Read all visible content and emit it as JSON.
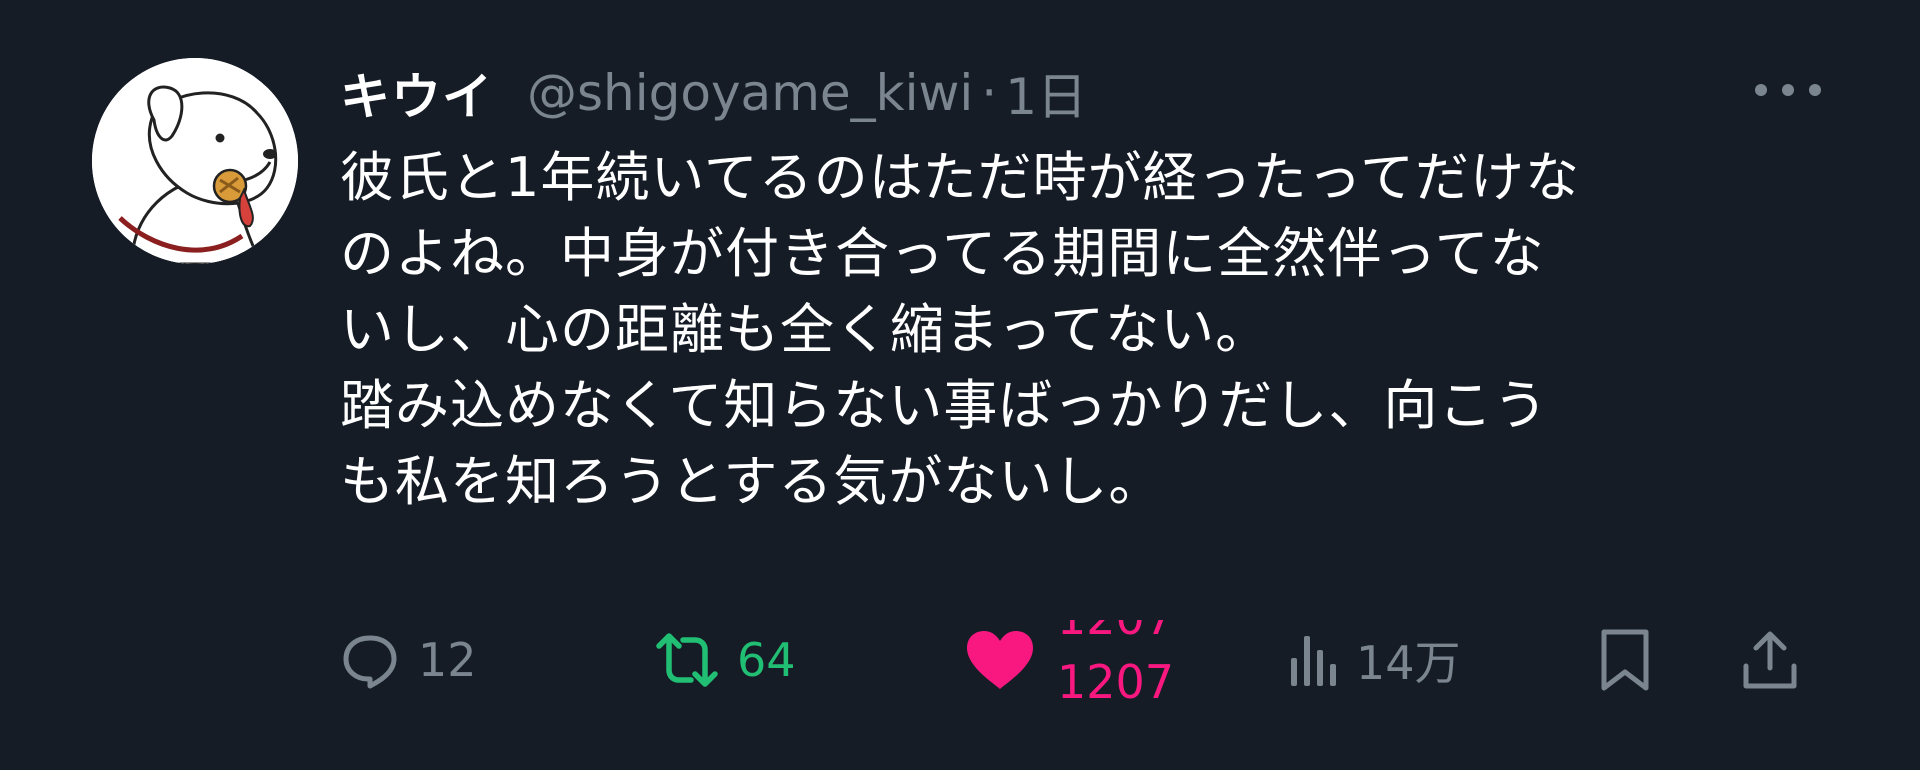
{
  "author": {
    "display_name": "キウイ",
    "handle": "@shigoyame_kiwi",
    "separator": "·",
    "time": "1日"
  },
  "tweet": {
    "lines": [
      "彼氏と1年続いてるのはただ時が経ったってだけな",
      "のよね。中身が付き合ってる期間に全然伴ってな",
      "いし、心の距離も全く縮まってない。",
      "踏み込めなくて知らない事ばっかりだし、向こう",
      "も私を知ろうとする気がないし。"
    ]
  },
  "actions": {
    "reply_count": "12",
    "retweet_count": "64",
    "like_count_old": "1207",
    "like_count_new": "1207",
    "views_count": "14万"
  },
  "icons": {
    "more": "more-icon",
    "reply": "reply-icon",
    "retweet": "retweet-icon",
    "like": "heart-icon",
    "views": "views-icon",
    "bookmark": "bookmark-icon",
    "share": "share-icon"
  },
  "colors": {
    "background": "#151c26",
    "text": "#ffffff",
    "muted": "#7b8590",
    "retweet": "#21bf73",
    "like": "#f91880"
  }
}
